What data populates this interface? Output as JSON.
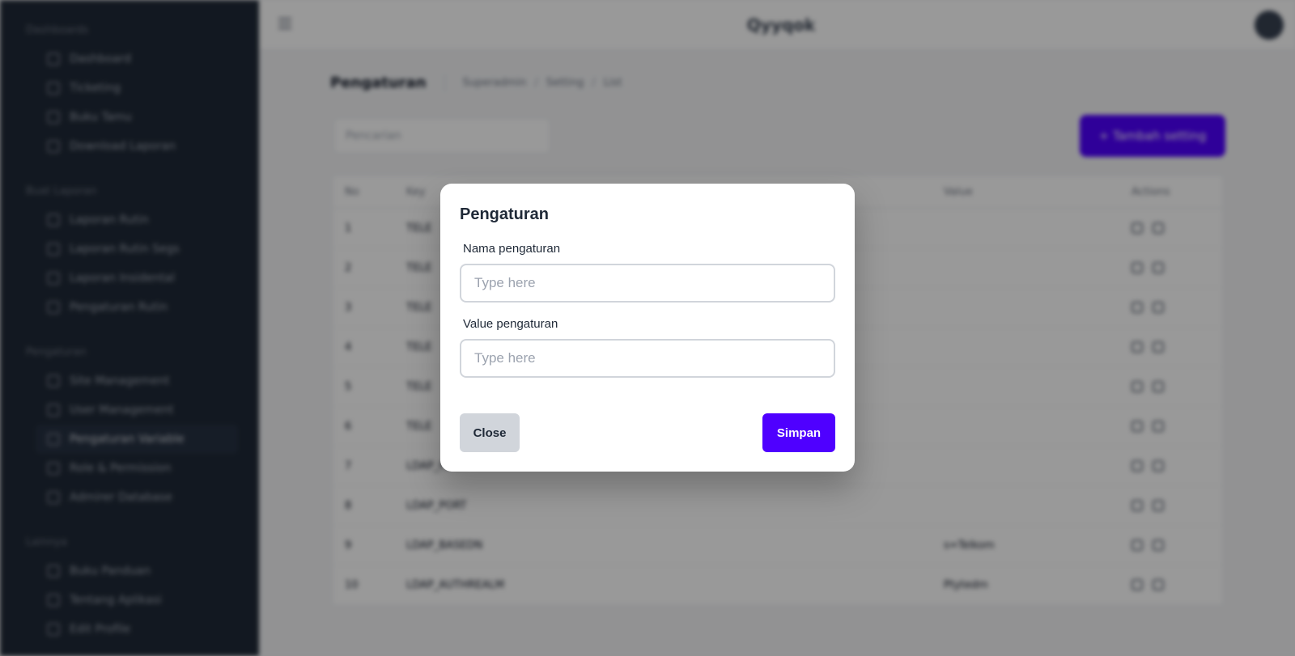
{
  "app": {
    "brand": "Qyyqok"
  },
  "sidebar": {
    "sections": [
      {
        "title": "Dashboards",
        "items": [
          {
            "label": "Dashboard"
          },
          {
            "label": "Ticketing"
          },
          {
            "label": "Buku Tamu"
          },
          {
            "label": "Download Laporan"
          }
        ]
      },
      {
        "title": "Buat Laporan",
        "items": [
          {
            "label": "Laporan Rutin"
          },
          {
            "label": "Laporan Rutin Segs"
          },
          {
            "label": "Laporan Insidental"
          },
          {
            "label": "Pengaturan Rutin"
          }
        ]
      },
      {
        "title": "Pengaturan",
        "items": [
          {
            "label": "Site Management"
          },
          {
            "label": "User Management"
          },
          {
            "label": "Pengaturan Variable",
            "active": true
          },
          {
            "label": "Role & Permission"
          },
          {
            "label": "Admirer Database"
          }
        ]
      },
      {
        "title": "Lainnya",
        "items": [
          {
            "label": "Buku Panduan"
          },
          {
            "label": "Tentang Aplikasi"
          },
          {
            "label": "Edit Profile"
          }
        ]
      }
    ]
  },
  "page": {
    "title": "Pengaturan",
    "breadcrumb": [
      "Superadmin",
      "Setting",
      "List"
    ],
    "search_placeholder": "Pencarian",
    "add_button": "+  Tambah setting"
  },
  "table": {
    "headers": {
      "no": "No",
      "key": "Key",
      "value": "Value",
      "actions": "Actions"
    },
    "rows": [
      {
        "no": "1",
        "key": "TELE",
        "value": ""
      },
      {
        "no": "2",
        "key": "TELE",
        "value": ""
      },
      {
        "no": "3",
        "key": "TELE",
        "value": ""
      },
      {
        "no": "4",
        "key": "TELE",
        "value": ""
      },
      {
        "no": "5",
        "key": "TELE",
        "value": ""
      },
      {
        "no": "6",
        "key": "TELE",
        "value": ""
      },
      {
        "no": "7",
        "key": "LDAP_HOST",
        "value": ""
      },
      {
        "no": "8",
        "key": "LDAP_PORT",
        "value": ""
      },
      {
        "no": "9",
        "key": "LDAP_BASEDN",
        "value": "s=Telkom"
      },
      {
        "no": "10",
        "key": "LDAP_AUTHREALM",
        "value": "Ptytedm"
      }
    ]
  },
  "modal": {
    "title": "Pengaturan",
    "name_label": "Nama pengaturan",
    "name_placeholder": "Type here",
    "value_label": "Value pengaturan",
    "value_placeholder": "Type here",
    "close_label": "Close",
    "save_label": "Simpan"
  }
}
